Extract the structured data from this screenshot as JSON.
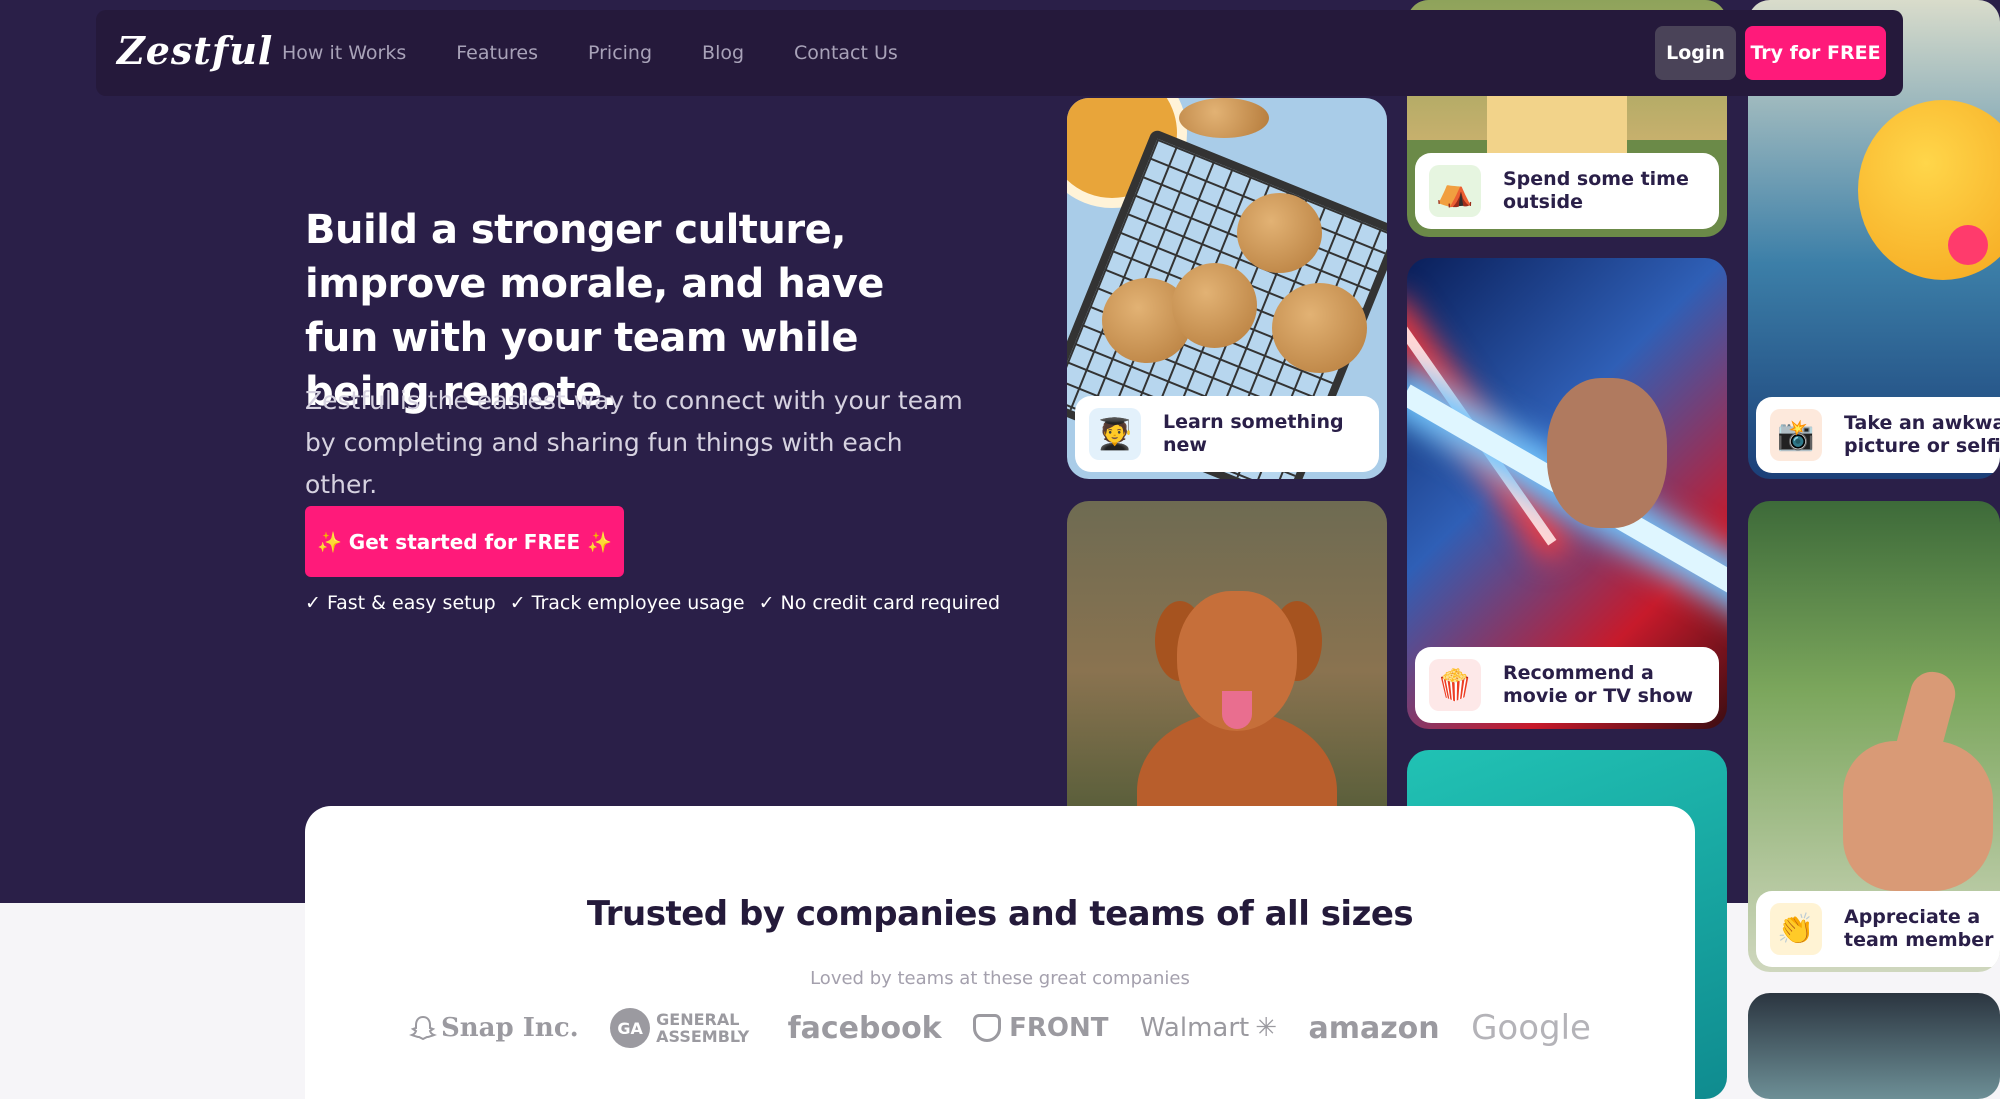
{
  "nav": {
    "logo": "Zestful",
    "links": [
      "How it Works",
      "Features",
      "Pricing",
      "Blog",
      "Contact Us"
    ],
    "login": "Login",
    "try_free": "Try for FREE"
  },
  "hero": {
    "headline": "Build a stronger culture, improve morale, and have fun with your team while being remote.",
    "subtext": "Zestful is the easiest way to connect with your team by completing and sharing fun things with each other.",
    "cta": "✨ Get started for FREE ✨",
    "checks": [
      "✓ Fast & easy setup",
      "✓ Track employee usage",
      "✓ No credit card required"
    ]
  },
  "cards": {
    "camp": {
      "icon": "tent-icon",
      "emoji": "⛺",
      "label": "Spend some time outside"
    },
    "learn": {
      "icon": "student-icon",
      "emoji": "🧑‍🎓",
      "label": "Learn something new"
    },
    "movie": {
      "icon": "popcorn-icon",
      "emoji": "🍿",
      "label": "Recommend a movie or TV show"
    },
    "selfie": {
      "icon": "camera-icon",
      "emoji": "📸",
      "label": "Take an awkward picture or selfie"
    },
    "appreciate": {
      "icon": "clapping-hands-icon",
      "emoji": "👏",
      "label": "Appreciate a team member"
    }
  },
  "trust": {
    "title": "Trusted by companies and teams of all sizes",
    "subtitle": "Loved by teams at these great companies",
    "logos": [
      "Snap Inc.",
      "GENERAL ASSEMBLY",
      "facebook",
      "FRONT",
      "Walmart",
      "amazon",
      "Google"
    ]
  },
  "colors": {
    "background": "#2a1f48",
    "accent": "#ff1a7a",
    "nav_bg": "#25193b"
  }
}
